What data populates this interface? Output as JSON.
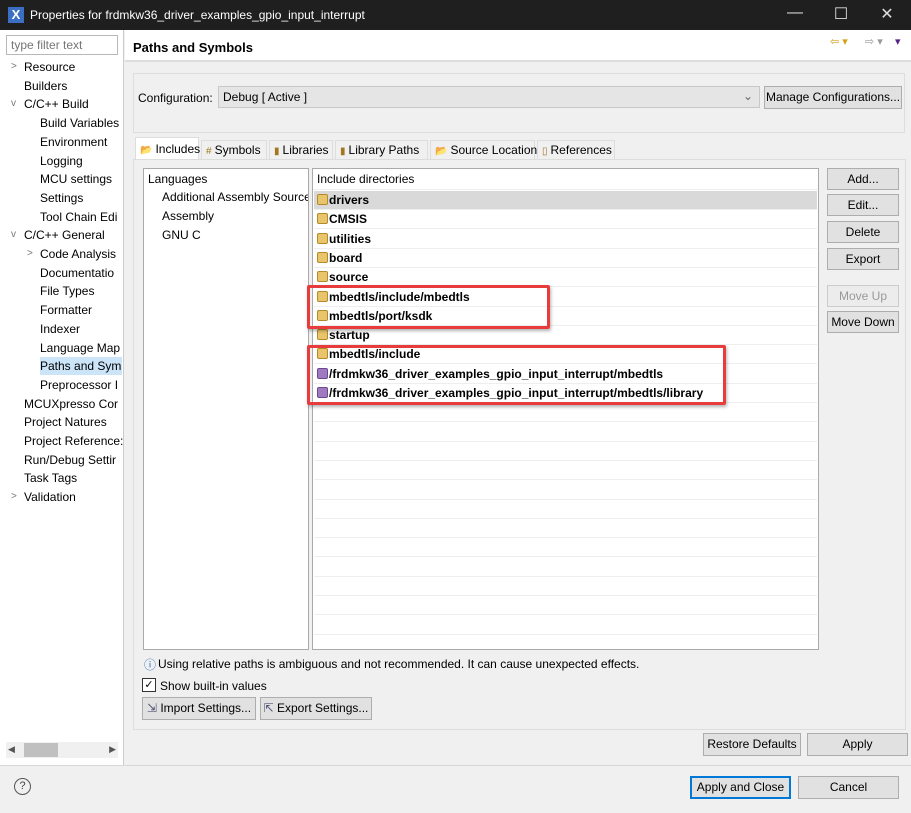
{
  "window": {
    "title": "Properties for frdmkw36_driver_examples_gpio_input_interrupt",
    "minimize": "—",
    "maximize": "☐",
    "close": "✕",
    "app_icon": "X"
  },
  "sidebar": {
    "filter_placeholder": "type filter text",
    "items": [
      {
        "label": "Resource",
        "level": 0,
        "twisty": ">"
      },
      {
        "label": "Builders",
        "level": 0,
        "twisty": ""
      },
      {
        "label": "C/C++ Build",
        "level": 0,
        "twisty": "v"
      },
      {
        "label": "Build Variables",
        "level": 1,
        "twisty": ""
      },
      {
        "label": "Environment",
        "level": 1,
        "twisty": ""
      },
      {
        "label": "Logging",
        "level": 1,
        "twisty": ""
      },
      {
        "label": "MCU settings",
        "level": 1,
        "twisty": ""
      },
      {
        "label": "Settings",
        "level": 1,
        "twisty": ""
      },
      {
        "label": "Tool Chain Edi",
        "level": 1,
        "twisty": ""
      },
      {
        "label": "C/C++ General",
        "level": 0,
        "twisty": "v"
      },
      {
        "label": "Code Analysis",
        "level": 1,
        "twisty": ">"
      },
      {
        "label": "Documentatio",
        "level": 1,
        "twisty": ""
      },
      {
        "label": "File Types",
        "level": 1,
        "twisty": ""
      },
      {
        "label": "Formatter",
        "level": 1,
        "twisty": ""
      },
      {
        "label": "Indexer",
        "level": 1,
        "twisty": ""
      },
      {
        "label": "Language Map",
        "level": 1,
        "twisty": ""
      },
      {
        "label": "Paths and Sym",
        "level": 1,
        "twisty": "",
        "selected": true
      },
      {
        "label": "Preprocessor I",
        "level": 1,
        "twisty": ""
      },
      {
        "label": "MCUXpresso Cor",
        "level": 0,
        "twisty": ""
      },
      {
        "label": "Project Natures",
        "level": 0,
        "twisty": ""
      },
      {
        "label": "Project Reference:",
        "level": 0,
        "twisty": ""
      },
      {
        "label": "Run/Debug Settir",
        "level": 0,
        "twisty": ""
      },
      {
        "label": "Task Tags",
        "level": 0,
        "twisty": ""
      },
      {
        "label": "Validation",
        "level": 0,
        "twisty": ">"
      }
    ]
  },
  "page": {
    "title": "Paths and Symbols",
    "nav": {
      "back": "⇦ ▾",
      "forward": "⇨ ▾",
      "menu": "▾"
    }
  },
  "config": {
    "label": "Configuration:",
    "value": "Debug  [ Active ]",
    "chevron": "⌄",
    "manage": "Manage Configurations..."
  },
  "tabs": [
    {
      "icon": "📂",
      "label": "Includes",
      "active": true
    },
    {
      "icon": "#",
      "label": "Symbols"
    },
    {
      "icon": "▮",
      "label": "Libraries"
    },
    {
      "icon": "▮",
      "label": "Library Paths"
    },
    {
      "icon": "📂",
      "label": "Source Location"
    },
    {
      "icon": "▯",
      "label": "References"
    }
  ],
  "languages": {
    "header": "Languages",
    "items": [
      "Additional Assembly Source",
      "Assembly",
      "GNU C"
    ]
  },
  "includes": {
    "header": "Include directories",
    "items": [
      {
        "path": "drivers",
        "type": "inc"
      },
      {
        "path": "CMSIS",
        "type": "inc"
      },
      {
        "path": "utilities",
        "type": "inc"
      },
      {
        "path": "board",
        "type": "inc"
      },
      {
        "path": "source",
        "type": "inc"
      },
      {
        "path": "mbedtls/include/mbedtls",
        "type": "inc"
      },
      {
        "path": "mbedtls/port/ksdk",
        "type": "inc"
      },
      {
        "path": "startup",
        "type": "inc"
      },
      {
        "path": "mbedtls/include",
        "type": "inc"
      },
      {
        "path": "/frdmkw36_driver_examples_gpio_input_interrupt/mbedtls",
        "type": "ws"
      },
      {
        "path": "/frdmkw36_driver_examples_gpio_input_interrupt/mbedtls/library",
        "type": "ws"
      }
    ]
  },
  "buttons": {
    "add": "Add...",
    "edit": "Edit...",
    "delete": "Delete",
    "export": "Export",
    "move_up": "Move Up",
    "move_down": "Move Down"
  },
  "info": {
    "icon": "ⓘ",
    "text": "Using relative paths is ambiguous and not recommended. It can cause unexpected effects."
  },
  "show_builtin": {
    "label": "Show built-in values",
    "checked": true,
    "mark": "✓"
  },
  "import_settings": "Import Settings...",
  "export_settings": "Export Settings...",
  "restore_defaults": "Restore Defaults",
  "apply": "Apply",
  "help_icon": "?",
  "apply_close": "Apply and Close",
  "cancel": "Cancel"
}
